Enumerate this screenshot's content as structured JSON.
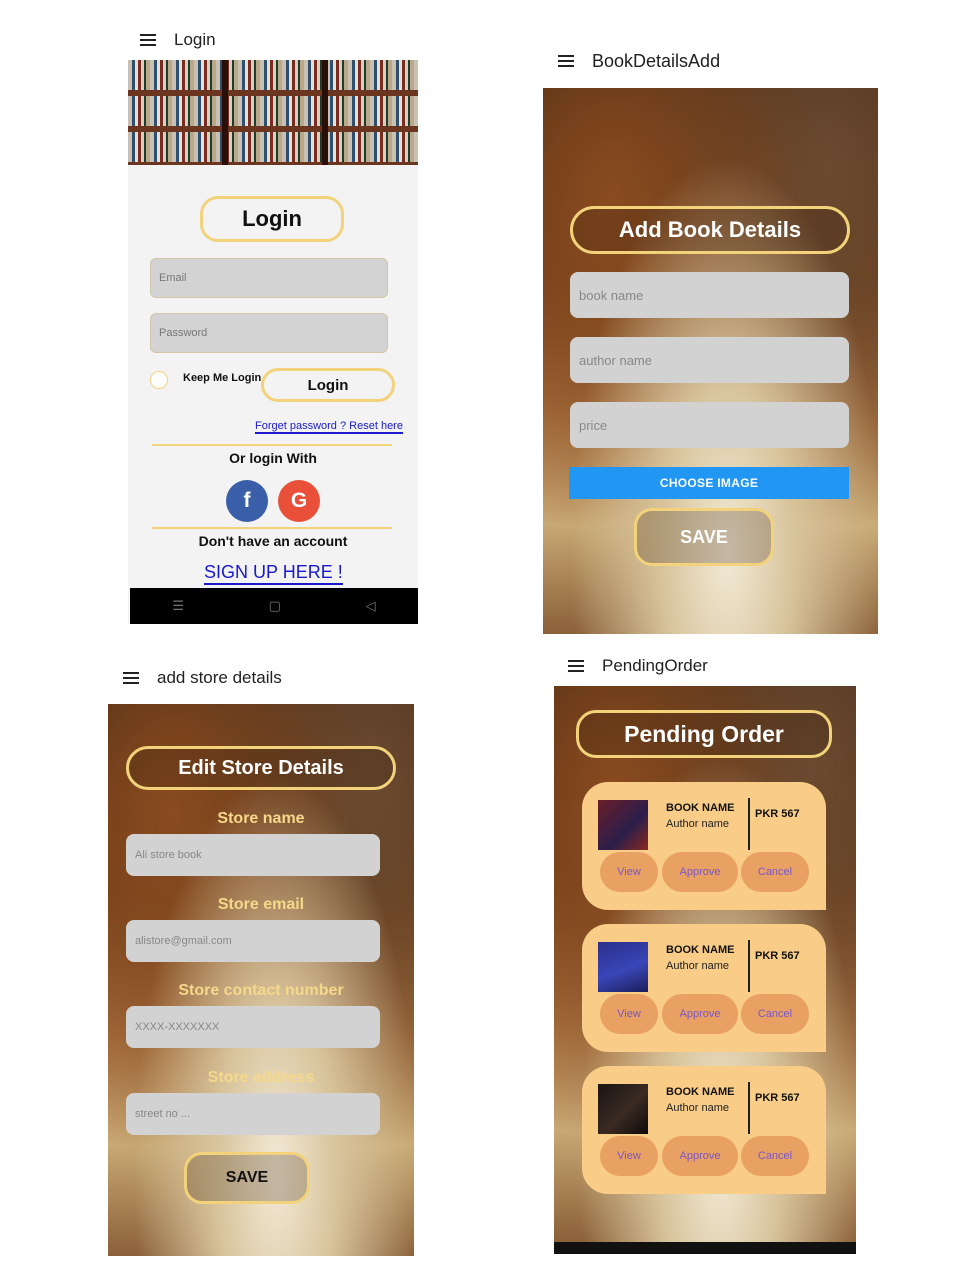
{
  "login_screen": {
    "appbar_title": "Login",
    "header_label": "Login",
    "email_placeholder": "Email",
    "password_placeholder": "Password",
    "keep_me_login": "Keep Me Login",
    "login_button": "Login",
    "forget_password": "Forget password ? Reset here",
    "or_login_with": "Or login With",
    "facebook_icon_char": "f",
    "google_icon_char": "G",
    "no_account": "Don't have an account",
    "sign_up": "SIGN UP HERE !",
    "nav_menu": "☰",
    "nav_home": "▢",
    "nav_back": "◁",
    "colors": {
      "facebook": "#3b5ea8",
      "google": "#e8503a",
      "accent": "#f2d27a",
      "link": "#1a1acc"
    }
  },
  "book_details_screen": {
    "appbar_title": "BookDetailsAdd",
    "header_label": "Add Book Details",
    "book_name_placeholder": "book name",
    "author_name_placeholder": "author name",
    "price_placeholder": "price",
    "choose_image": "CHOOSE IMAGE",
    "save": "SAVE",
    "colors": {
      "choose_image": "#2196f3"
    }
  },
  "store_details_screen": {
    "appbar_title": "add store details",
    "header_label": "Edit Store Details",
    "store_name_label": "Store name",
    "store_name_placeholder": "Ali store book",
    "store_email_label": "Store email",
    "store_email_placeholder": "alistore@gmail.com",
    "store_contact_label": "Store contact number",
    "store_contact_placeholder": "XXXX-XXXXXXX",
    "store_address_label": "Store address",
    "store_address_placeholder": "street no ...",
    "save": "SAVE"
  },
  "pending_order_screen": {
    "appbar_title": "PendingOrder",
    "header_label": "Pending Order",
    "orders": [
      {
        "book_name": "BOOK NAME",
        "author": "Author name",
        "price": "PKR 567",
        "view": "View",
        "approve": "Approve",
        "cancel": "Cancel"
      },
      {
        "book_name": "BOOK NAME",
        "author": "Author name",
        "price": "PKR 567",
        "view": "View",
        "approve": "Approve",
        "cancel": "Cancel"
      },
      {
        "book_name": "BOOK NAME",
        "author": "Author name",
        "price": "PKR 567",
        "view": "View",
        "approve": "Approve",
        "cancel": "Cancel"
      }
    ],
    "colors": {
      "card": "#f9cc88",
      "action_button": "#e8a063",
      "action_text": "#7a56c8"
    }
  }
}
